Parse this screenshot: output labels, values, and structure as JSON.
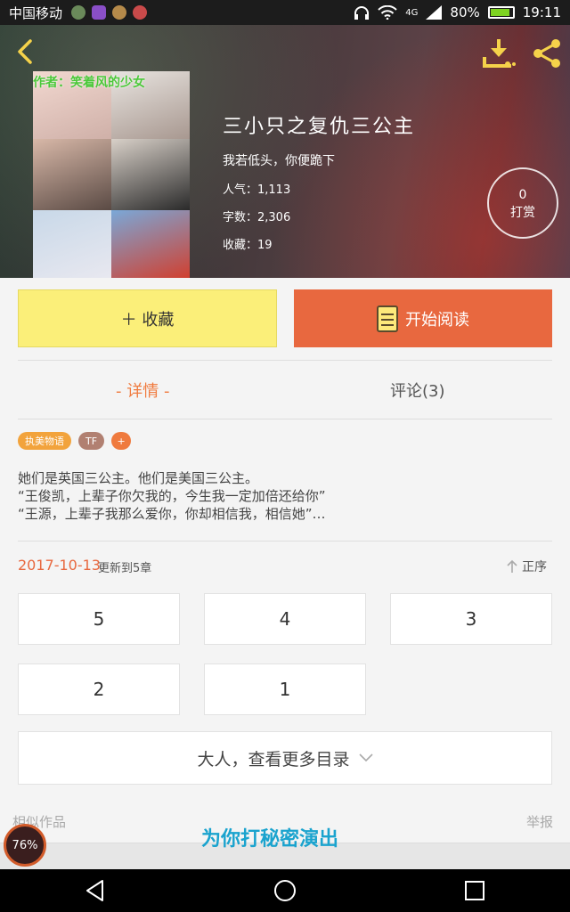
{
  "status_bar": {
    "carrier": "中国移动",
    "network": "4G",
    "battery": "80%",
    "time": "19:11"
  },
  "header": {
    "icons": [
      "back-icon",
      "download-icon",
      "share-icon"
    ]
  },
  "book": {
    "cover_author_text": "作者：笑着风的少女",
    "title": "三小只之复仇三公主",
    "subtitle": "我若低头，你便跪下",
    "popularity": "人气：1,113",
    "word_count": "字数：2,306",
    "favorites": "收藏：19",
    "tip_count": "0",
    "tip_label": "打赏"
  },
  "actions": {
    "favorite_label": "＋ 收藏",
    "read_label": "开始阅读"
  },
  "tabs": {
    "details": "- 详情 -",
    "comments": "评论(3)"
  },
  "tags": [
    "执美物语",
    "TF",
    "+"
  ],
  "summary": [
    "她们是英国三公主。他们是美国三公主。",
    "“王俊凯，上辈子你欠我的，今生我一定加倍还给你”",
    "“王源，上辈子我那么爱你，你却相信我，相信她”…"
  ],
  "update": {
    "date": "2017-10-13",
    "text": "更新到5章",
    "sort_label": "正序"
  },
  "chapters": [
    "5",
    "4",
    "3",
    "2",
    "1"
  ],
  "more_label": "大人，查看更多目录",
  "footer": {
    "similar": "相似作品",
    "report": "举报",
    "banner": "为你打秘密演出",
    "badge": "76%"
  },
  "colors": {
    "accent": "#e8683f",
    "favorite_bg": "#fbef79",
    "tab_active": "#f07b3f"
  }
}
